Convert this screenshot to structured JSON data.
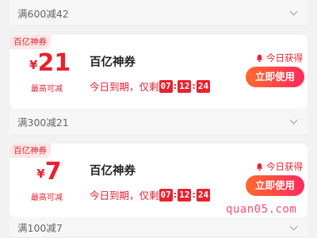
{
  "rules": [
    {
      "label": "满600减42"
    },
    {
      "label": "满300减21"
    },
    {
      "label": "满100减7"
    }
  ],
  "coupons": [
    {
      "tag": "百亿神券",
      "currency": "¥",
      "amount": "21",
      "sublabel": "最高可减",
      "title": "百亿神券",
      "expire_prefix": "今日到期，仅剩",
      "hh": "07",
      "mm": "12",
      "ss": "24",
      "obtained": "今日获得",
      "button": "立即使用"
    },
    {
      "tag": "百亿神券",
      "currency": "¥",
      "amount": "7",
      "sublabel": "最高可减",
      "title": "百亿神券",
      "expire_prefix": "今日到期，仅剩",
      "hh": "07",
      "mm": "12",
      "ss": "24",
      "obtained": "今日获得",
      "button": "立即使用"
    }
  ],
  "watermark": "quan05.com",
  "colors": {
    "accent": "#e8222e",
    "button_start": "#ff6a2c",
    "button_end": "#ff2a5c"
  }
}
